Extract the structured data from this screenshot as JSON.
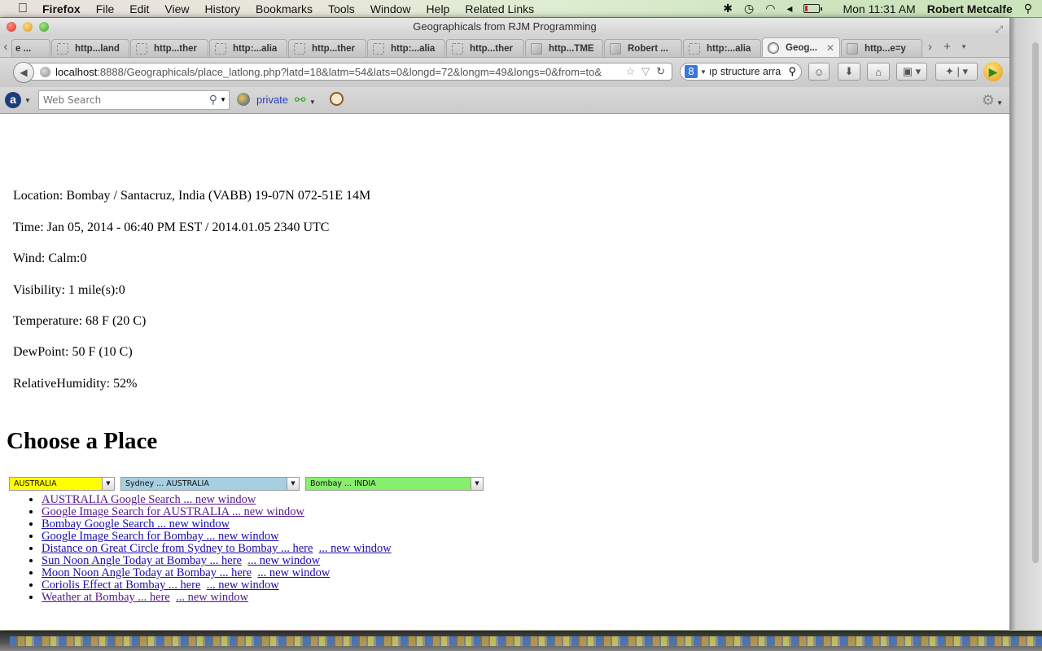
{
  "menubar": {
    "app": "Firefox",
    "items": [
      "File",
      "Edit",
      "View",
      "History",
      "Bookmarks",
      "Tools",
      "Window",
      "Help",
      "Related Links"
    ],
    "clock": "Mon 11:31 AM",
    "user": "Robert Metcalfe"
  },
  "window": {
    "title": "Geographicals from RJM Programming"
  },
  "tabs": [
    {
      "label": "e ...",
      "icon": "none"
    },
    {
      "label": "http...land",
      "icon": "blank-page-icon"
    },
    {
      "label": "http...ther",
      "icon": "blank-page-icon"
    },
    {
      "label": "http:...alia",
      "icon": "blank-page-icon"
    },
    {
      "label": "http...ther",
      "icon": "blank-page-icon"
    },
    {
      "label": "http:...alia",
      "icon": "blank-page-icon"
    },
    {
      "label": "http...ther",
      "icon": "blank-page-icon"
    },
    {
      "label": "http...TME",
      "icon": "image-icon"
    },
    {
      "label": "Robert ...",
      "icon": "image-icon"
    },
    {
      "label": "http:...alia",
      "icon": "blank-page-icon"
    },
    {
      "label": "Geog...",
      "icon": "globe-icon",
      "active": true
    },
    {
      "label": "http...e=y",
      "icon": "image-icon"
    }
  ],
  "navbar": {
    "url_host": "localhost",
    "url_rest": ":8888/Geographicals/place_latlong.php?latd=18&latm=54&lats=0&longd=72&longm=49&longs=0&from=to&",
    "search_value": "ıp structure arra"
  },
  "addonbar": {
    "web_search_placeholder": "Web Search",
    "private_label": "private"
  },
  "weather": {
    "location": "Location: Bombay / Santacruz, India (VABB) 19-07N 072-51E 14M",
    "time": "Time: Jan 05, 2014 - 06:40 PM EST / 2014.01.05 2340 UTC",
    "wind": "Wind: Calm:0",
    "visibility": "Visibility: 1 mile(s):0",
    "temperature": "Temperature: 68 F (20 C)",
    "dewpoint": "DewPoint: 50 F (10 C)",
    "humidity": "RelativeHumidity: 52%"
  },
  "choose": {
    "heading": "Choose a Place",
    "selects": [
      {
        "value": "AUSTRALIA",
        "color": "#ffff00"
      },
      {
        "value": "Sydney ... AUSTRALIA",
        "color": "#a6cfe2"
      },
      {
        "value": "Bombay ... INDIA",
        "color": "#88ee6e"
      }
    ],
    "links": [
      {
        "main": "AUSTRALIA Google Search ... new window",
        "visited": true
      },
      {
        "main": "Google Image Search for AUSTRALIA ... new window",
        "visited": true
      },
      {
        "main": "Bombay Google Search ... new window"
      },
      {
        "main": "Google Image Search for Bombay ... new window"
      },
      {
        "main": "Distance on Great Circle from Sydney to Bombay ... here",
        "extra": "... new window"
      },
      {
        "main": "Sun Noon Angle Today at Bombay ... here",
        "extra": "... new window"
      },
      {
        "main": "Moon Noon Angle Today at Bombay ... here",
        "extra": "... new window"
      },
      {
        "main": "Coriolis Effect at Bombay ... here",
        "extra": "... new window"
      },
      {
        "main": "Weather at Bombay ... here",
        "extra": "... new window",
        "visited": true
      }
    ]
  }
}
